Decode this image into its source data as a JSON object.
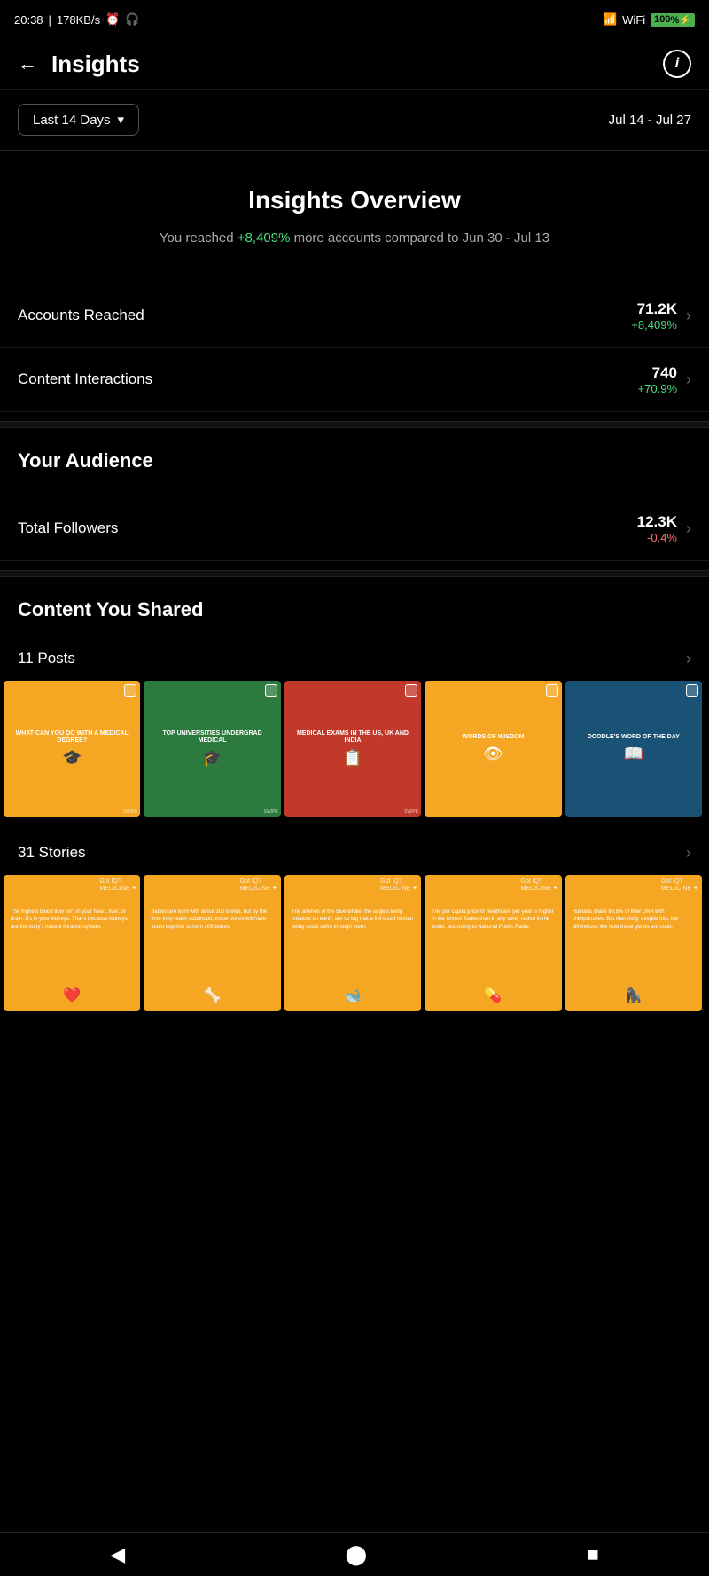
{
  "statusBar": {
    "time": "20:38",
    "network": "178KB/s",
    "battery": "100"
  },
  "header": {
    "back_label": "←",
    "title": "Insights",
    "info_label": "i"
  },
  "filterBar": {
    "period_label": "Last 14 Days",
    "chevron": "▾",
    "date_range": "Jul 14 - Jul 27"
  },
  "insightsOverview": {
    "title": "Insights Overview",
    "subtitle_prefix": "You reached ",
    "highlight": "+8,409%",
    "subtitle_suffix": " more accounts compared to Jun 30 - Jul 13"
  },
  "stats": [
    {
      "label": "Accounts Reached",
      "number": "71.2K",
      "change": "+8,409%",
      "change_type": "positive"
    },
    {
      "label": "Content Interactions",
      "number": "740",
      "change": "+70.9%",
      "change_type": "positive"
    }
  ],
  "audience": {
    "section_title": "Your Audience",
    "follower_label": "Total Followers",
    "follower_count": "12.3K",
    "follower_change": "-0.4%",
    "follower_change_type": "negative"
  },
  "contentShared": {
    "section_title": "Content You Shared",
    "posts_label": "11 Posts",
    "stories_label": "31 Stories"
  },
  "posts": [
    {
      "bg": "#f5a623",
      "title": "WHAT CAN YOU DO WITH A MEDICAL DEGREE?",
      "icon": "🎓",
      "swipe": "SWIPE"
    },
    {
      "bg": "#2d7a3e",
      "title": "TOP UNIVERSITIES UNDERGRAD MEDICAL",
      "icon": "🎓",
      "swipe": "SWIPE"
    },
    {
      "bg": "#c0392b",
      "title": "MEDICAL EXAMS IN THE US, UK AND INDIA",
      "icon": "📋",
      "swipe": "SWIPE"
    },
    {
      "bg": "#f5a623",
      "title": "WORDS OF WISDOM",
      "icon": "👁",
      "swipe": ""
    },
    {
      "bg": "#1a5276",
      "title": "DOODLE'S WORD OF THE DAY",
      "icon": "📖",
      "swipe": ""
    }
  ],
  "stories": [
    {
      "bg": "#f5a623",
      "text": "The highest blood flow isn't in your heart, liver, or brain. It's in your kidneys. That's because kidneys are the body's natural filtration system.",
      "icon": "❤️"
    },
    {
      "bg": "#f5a623",
      "text": "Babies are born with about 300 bones, but by the time they reach adulthood, these bones will have fused together to form 206 bones.",
      "icon": "🦴"
    },
    {
      "bg": "#f5a623",
      "text": "The arteries of the blue whale, the largest living creature on earth, are so big that a full-sized human being could swim through them.",
      "icon": "🐋"
    },
    {
      "bg": "#f5a623",
      "text": "The per capita price of healthcare per year is higher in the United States than in any other nation in the world, according to National Public Radio.",
      "icon": "💊"
    },
    {
      "bg": "#f5a623",
      "text": "Humans share 98.8% of their DNA with chimpanzees. But thankfully, despite this, the differences like how these genes are used.",
      "icon": "🦍"
    }
  ],
  "navBar": {
    "back_label": "◀",
    "home_label": "⬤",
    "square_label": "■"
  }
}
